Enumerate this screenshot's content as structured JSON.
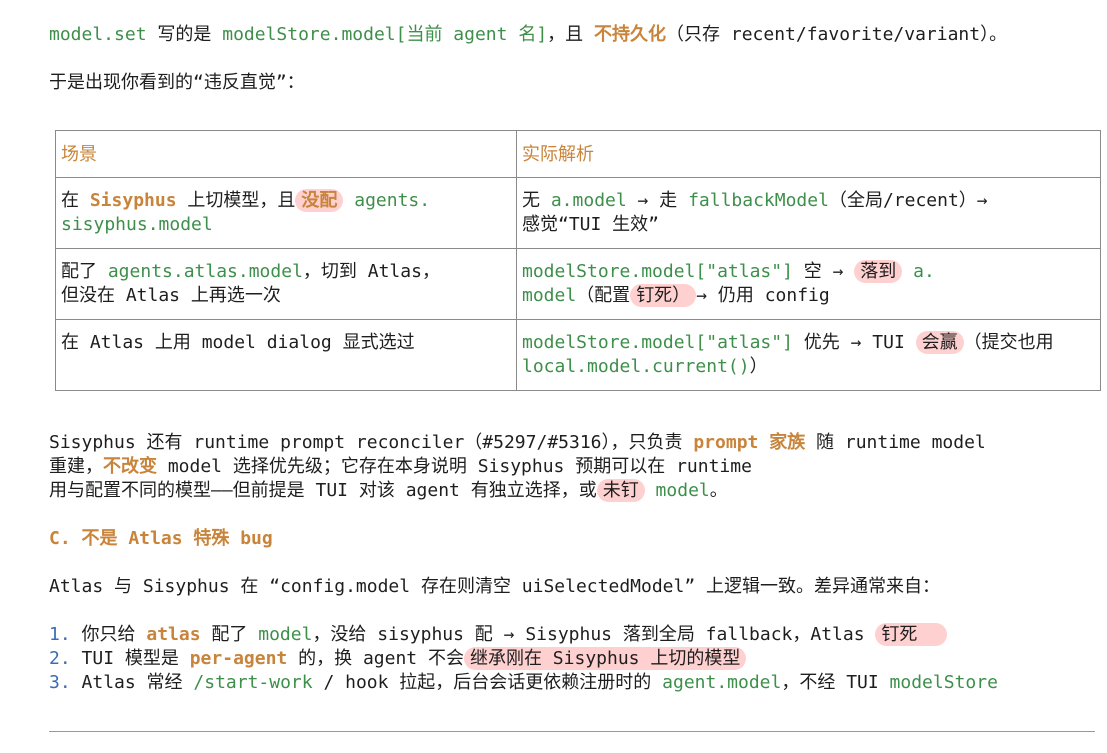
{
  "para1": {
    "t1": "model.set",
    "t2": " 写的是 ",
    "t3": "modelStore.model[当前 agent 名]",
    "t4": "，且 ",
    "t5": "不持久化",
    "t6": "（只存 recent/favorite/variant）。"
  },
  "para2": "于是出现你看到的“违反直觉”：",
  "table": {
    "headers": [
      "场景",
      "实际解析"
    ],
    "r1": {
      "a1": "在 ",
      "a2": "Sisyphus",
      "a3": " 上切模型，且",
      "a4": "没配",
      "a5": " agents.",
      "a6": "sisyphus.model",
      "b1": "无 ",
      "b2": "a.model",
      "b3": " → 走 ",
      "b4": "fallbackModel",
      "b5": "（全局/recent）→",
      "b6": "感觉“TUI 生效”"
    },
    "r2": {
      "a1": "配了 ",
      "a2": "agents.atlas.model",
      "a3": "，切到 Atlas，",
      "a4": "但没在 Atlas 上再选一次",
      "b1": "modelStore.model[\"atlas\"]",
      "b2": " 空 → ",
      "b3": "落到",
      "b4": " a.",
      "b5": "model",
      "b6": "（配置",
      "b7": "钉死）",
      "b8": "→ 仍用 config"
    },
    "r3": {
      "a1": "在 Atlas 上用 model dialog 显式选过",
      "b1": "modelStore.model[\"atlas\"]",
      "b2": " 优先 → TUI ",
      "b3": "会赢",
      "b4": "（提交也用",
      "b5": "local.model.current()",
      "b6": "）"
    }
  },
  "para3": {
    "l1a": "Sisyphus 还有 runtime prompt reconciler（#5297/#5316），只负责 ",
    "l1b": "prompt 家族",
    "l1c": " 随 runtime model",
    "l2a": "重建，",
    "l2b": "不改变",
    "l2c": " model 选择优先级；它存在本身说明 Sisyphus 预期可以在 runtime",
    "l3a": "用与配置不同的模型——但前提是 TUI 对该 agent 有独立选择，或",
    "l3b": "未钉",
    "l3c": " model",
    "l3d": "。"
  },
  "heading": "C. 不是 Atlas 特殊 bug",
  "para4": "Atlas 与 Sisyphus 在 “config.model 存在则清空 uiSelectedModel” 上逻辑一致。差异通常来自：",
  "list": {
    "i1": {
      "n": "1.",
      "a": " 你只给 ",
      "b": "atlas",
      "c": " 配了 ",
      "d": "model",
      "e": "，没给 sisyphus 配 → Sisyphus 落到全局 fallback，Atlas ",
      "f": "钉死"
    },
    "i2": {
      "n": "2.",
      "a": " TUI 模型是 ",
      "b": "per-agent",
      "c": " 的，换 agent 不会",
      "d": "继承刚在 Sisyphus 上切的模型"
    },
    "i3": {
      "n": "3.",
      "a": " Atlas 常经 ",
      "b": "/start-work",
      "c": " / hook 拉起，后台会话更依赖注册时的 ",
      "d": "agent.model",
      "e": "，不经 TUI ",
      "f": "modelStore"
    }
  }
}
